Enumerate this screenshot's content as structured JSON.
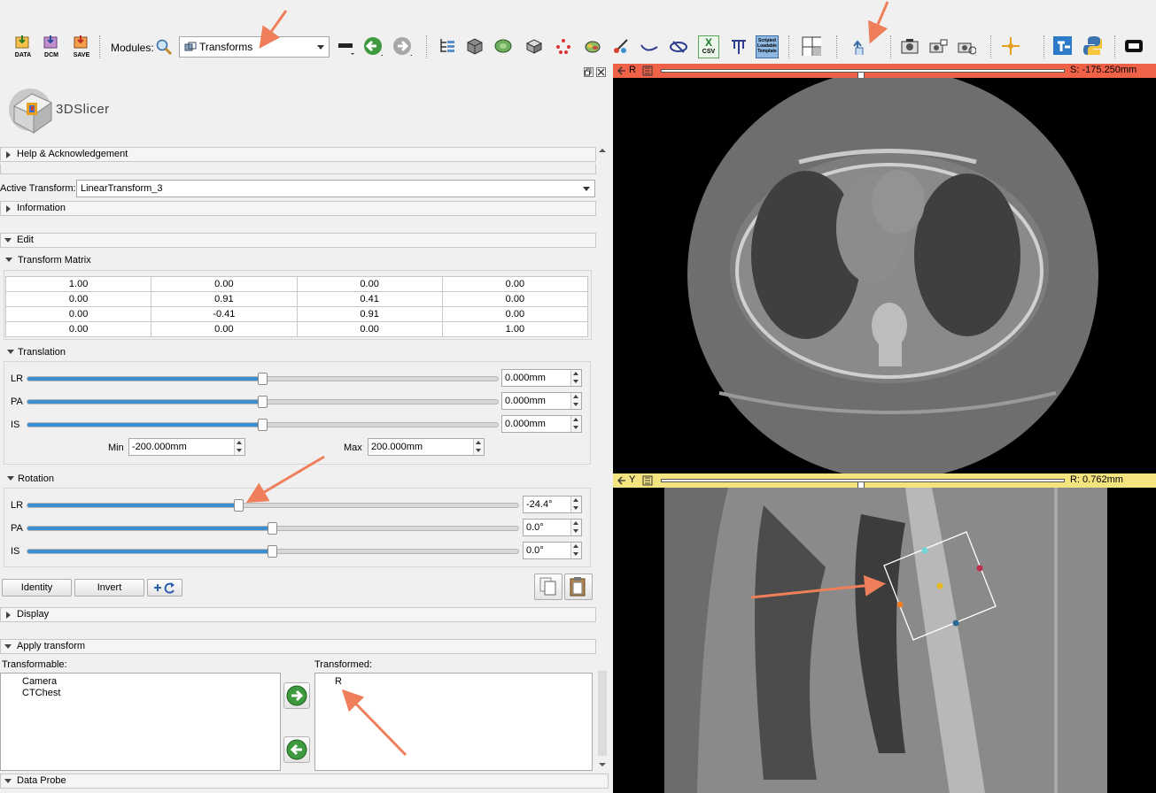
{
  "toolbar": {
    "data_label": "DATA",
    "dcm_label": "DCM",
    "save_label": "SAVE",
    "modules_label": "Modules:",
    "module_selected": "Transforms",
    "csv_label": "CSV",
    "scripted_label": "Scripted Loadable Template"
  },
  "logo": {
    "text": "3DSlicer"
  },
  "sections": {
    "help": "Help & Acknowledgement",
    "active_transform_label": "Active Transform:",
    "active_transform_value": "LinearTransform_3",
    "information": "Information",
    "edit": "Edit",
    "transform_matrix": "Transform Matrix",
    "translation": "Translation",
    "rotation": "Rotation",
    "display": "Display",
    "apply_transform": "Apply transform",
    "data_probe": "Data Probe"
  },
  "matrix": [
    [
      "1.00",
      "0.00",
      "0.00",
      "0.00"
    ],
    [
      "0.00",
      "0.91",
      "0.41",
      "0.00"
    ],
    [
      "0.00",
      "-0.41",
      "0.91",
      "0.00"
    ],
    [
      "0.00",
      "0.00",
      "0.00",
      "1.00"
    ]
  ],
  "translation": {
    "rows": [
      {
        "label": "LR",
        "value": "0.000mm",
        "level": 0.5
      },
      {
        "label": "PA",
        "value": "0.000mm",
        "level": 0.5
      },
      {
        "label": "IS",
        "value": "0.000mm",
        "level": 0.5
      }
    ],
    "min_label": "Min",
    "min_value": "-200.000mm",
    "max_label": "Max",
    "max_value": "200.000mm"
  },
  "rotation": {
    "rows": [
      {
        "label": "LR",
        "value": "-24.4°",
        "level": 0.432
      },
      {
        "label": "PA",
        "value": "0.0°",
        "level": 0.5
      },
      {
        "label": "IS",
        "value": "0.0°",
        "level": 0.5
      }
    ]
  },
  "buttons": {
    "identity": "Identity",
    "invert": "Invert"
  },
  "apply": {
    "transformable_label": "Transformable:",
    "transformable_items": [
      "Camera",
      "CTChest"
    ],
    "transformed_label": "Transformed:",
    "transformed_items": [
      "R"
    ]
  },
  "views": {
    "red": {
      "letter": "R",
      "offset": "S: -175.250mm",
      "level": 0.5
    },
    "yellow": {
      "letter": "Y",
      "offset": "R: 0.762mm",
      "level": 0.5
    }
  },
  "colors": {
    "red_bar": "#f06248",
    "yellow_bar": "#f4e47f",
    "slider_fill": "#3b8fd1",
    "annotation_arrow": "#ef7f5a"
  }
}
